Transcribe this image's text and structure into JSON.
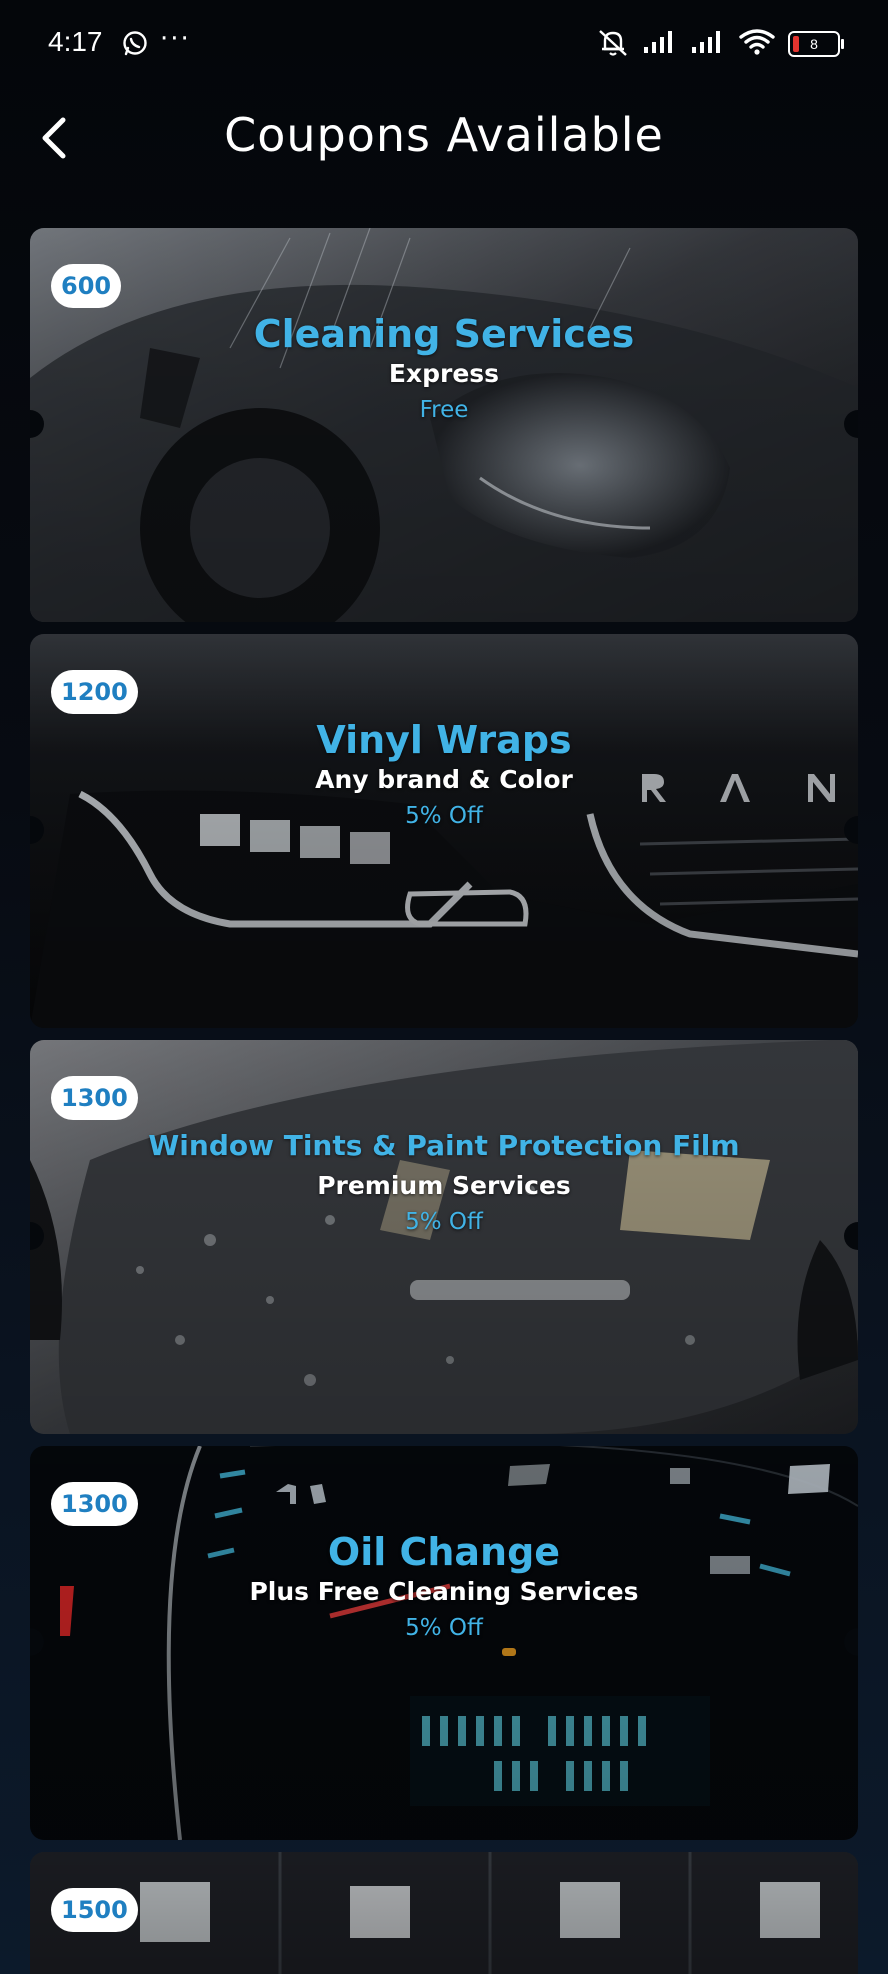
{
  "status_bar": {
    "time": "4:17",
    "dots": "···",
    "battery": "8",
    "icons": [
      "whatsapp-icon",
      "mute-icon",
      "signal-icon",
      "signal-icon",
      "wifi-icon",
      "battery-icon"
    ]
  },
  "header": {
    "title": "Coupons Available",
    "back_icon": "chevron-left-icon"
  },
  "colors": {
    "accent": "#41b3e6",
    "badge_text": "#1f7fc1",
    "background": "#05070b"
  },
  "coupons": [
    {
      "points": "600",
      "title": "Cleaning Services",
      "subtitle": "Express",
      "discount": "Free"
    },
    {
      "points": "1200",
      "title": "Vinyl Wraps",
      "subtitle": "Any brand & Color",
      "discount": "5% Off"
    },
    {
      "points": "1300",
      "title": "Window Tints & Paint Protection Film",
      "subtitle": "Premium Services",
      "discount": "5% Off"
    },
    {
      "points": "1300",
      "title": "Oil Change",
      "subtitle": "Plus Free Cleaning Services",
      "discount": "5% Off"
    },
    {
      "points": "1500",
      "title": "",
      "subtitle": "",
      "discount": ""
    }
  ]
}
